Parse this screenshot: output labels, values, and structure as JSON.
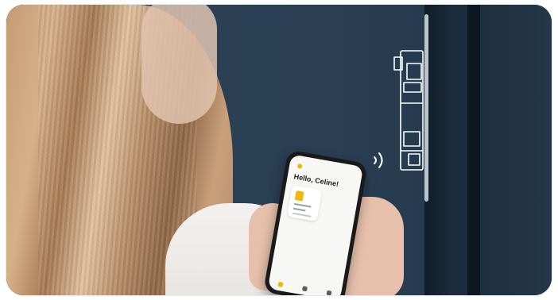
{
  "phone": {
    "greeting": "Hello, Celine!"
  },
  "icons": {
    "nfc": "nfc-waves-icon",
    "lock_diagram": "smart-lock-outline-icon",
    "app_home": "home-icon",
    "app_profile": "profile-icon",
    "app_settings": "settings-icon"
  },
  "colors": {
    "accent": "#f2b705",
    "door": "#2b4055",
    "line_art": "#ffffff"
  }
}
